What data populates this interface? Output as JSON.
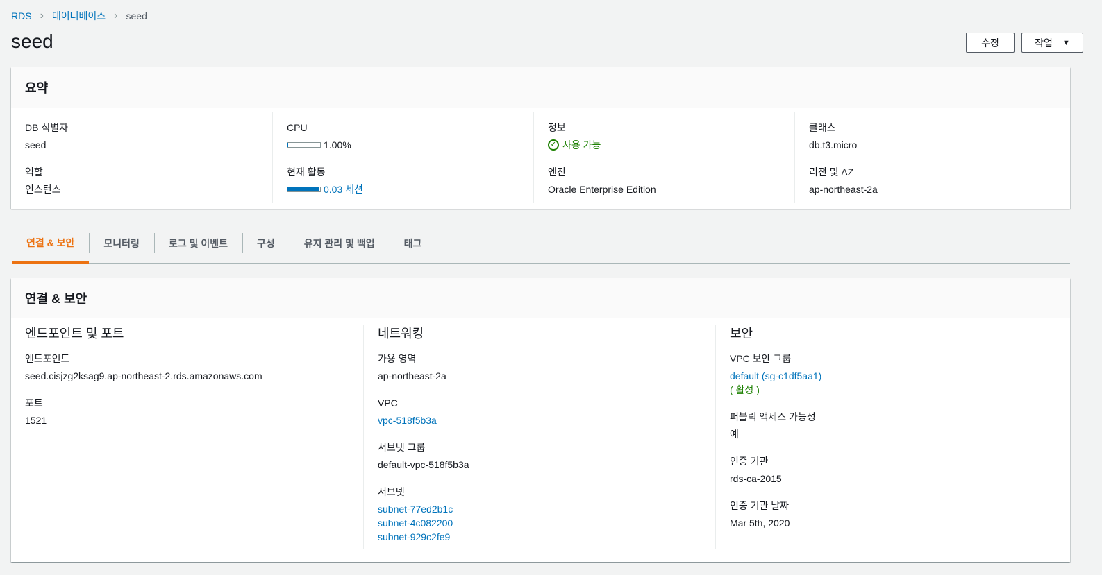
{
  "breadcrumb": {
    "root": "RDS",
    "section": "데이터베이스",
    "current": "seed"
  },
  "page_title": "seed",
  "actions": {
    "edit": "수정",
    "actions": "작업"
  },
  "summary": {
    "title": "요약",
    "db_id": {
      "label": "DB 식별자",
      "value": "seed"
    },
    "role": {
      "label": "역할",
      "value": "인스턴스"
    },
    "cpu": {
      "label": "CPU",
      "value": "1.00%",
      "fraction": 0.01
    },
    "activity": {
      "label": "현재 활동",
      "value": "0.03 세션",
      "fraction": 0.95
    },
    "status": {
      "label": "정보",
      "value": "사용 가능"
    },
    "engine": {
      "label": "엔진",
      "value": "Oracle Enterprise Edition"
    },
    "class": {
      "label": "클래스",
      "value": "db.t3.micro"
    },
    "region": {
      "label": "리전 및 AZ",
      "value": "ap-northeast-2a"
    }
  },
  "tabs": [
    "연결 & 보안",
    "모니터링",
    "로그 및 이벤트",
    "구성",
    "유지 관리 및 백업",
    "태그"
  ],
  "connectivity": {
    "title": "연결 & 보안",
    "endpoint_section": {
      "title": "엔드포인트 및 포트",
      "endpoint": {
        "label": "엔드포인트",
        "value": "seed.cisjzg2ksag9.ap-northeast-2.rds.amazonaws.com"
      },
      "port": {
        "label": "포트",
        "value": "1521"
      }
    },
    "network_section": {
      "title": "네트워킹",
      "az": {
        "label": "가용 영역",
        "value": "ap-northeast-2a"
      },
      "vpc": {
        "label": "VPC",
        "value": "vpc-518f5b3a"
      },
      "subnet_group": {
        "label": "서브넷 그룹",
        "value": "default-vpc-518f5b3a"
      },
      "subnets": {
        "label": "서브넷",
        "values": [
          "subnet-77ed2b1c",
          "subnet-4c082200",
          "subnet-929c2fe9"
        ]
      }
    },
    "security_section": {
      "title": "보안",
      "sg": {
        "label": "VPC 보안 그룹",
        "value": "default (sg-c1df5aa1)",
        "status": "( 활성 )"
      },
      "public": {
        "label": "퍼블릭 액세스 가능성",
        "value": "예"
      },
      "ca": {
        "label": "인증 기관",
        "value": "rds-ca-2015"
      },
      "ca_date": {
        "label": "인증 기관 날짜",
        "value": "Mar 5th, 2020"
      }
    }
  },
  "colors": {
    "link": "#0073bb",
    "success": "#1d8102",
    "active_tab": "#ec7211"
  }
}
